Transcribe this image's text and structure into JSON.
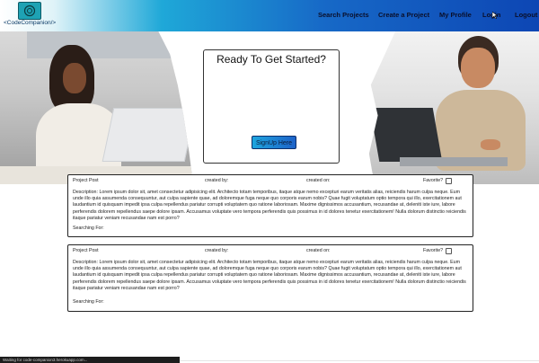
{
  "header": {
    "logo_text": "<CodeCompanion/>",
    "nav": [
      {
        "label": "Search Projects"
      },
      {
        "label": "Create a Project"
      },
      {
        "label": "My Profile"
      },
      {
        "label": "Login"
      },
      {
        "label": "Logout"
      }
    ],
    "colors": {
      "gradient_start": "#dff3f8",
      "gradient_end": "#0d46b4"
    }
  },
  "hero": {
    "title": "Ready To Get Started?",
    "signup_label": "SignUp Here"
  },
  "posts": [
    {
      "project_label": "Project Post",
      "created_by_label": "created by:",
      "created_on_label": "created on:",
      "favorite_label": "Favorite?",
      "description": "Description: Lorem ipsum dolor sit, amet consectetur adipisicing elit. Architecto totam temporibus, itaque atque nemo excepturi earum veritatis alias, reiciendis harum culpa neque. Eum unde illo quia assumenda consequuntur, aut culpa sapiente quae, ad doloremque fuga neque quo corporis earum nobis? Quae fugit voluptatum optio tempora qui illo, exercitationem aut laudantium id quisquam impedit ipsa culpa repellendus pariatur corrupti voluptatem quo ratione laboriosam. Maxime dignissimos accusantium, recusandae at, deleniti iste iure, labore perferendis dolorem repellendus saepe dolore ipsam. Accusamus voluptate vero tempora perferendis quis possimus in id dolores tenetur exercitationem! Nulla dolorum distinctio reiciendis itaque pariatur veniam recusandae nam est porro?",
      "searching_label": "Searching For:"
    },
    {
      "project_label": "Project Post",
      "created_by_label": "created by:",
      "created_on_label": "created on:",
      "favorite_label": "Favorite?",
      "description": "Description: Lorem ipsum dolor sit, amet consectetur adipisicing elit. Architecto totam temporibus, itaque atque nemo excepturi earum veritatis alias, reiciendis harum culpa neque. Eum unde illo quia assumenda consequuntur, aut culpa sapiente quae, ad doloremque fuga neque quo corporis earum nobis? Quae fugit voluptatum optio tempora qui illo, exercitationem aut laudantium id quisquam impedit ipsa culpa repellendus pariatur corrupti voluptatem quo ratione laboriosam. Maxime dignissimos accusantium, recusandae at, deleniti iste iure, labore perferendis dolorem repellendus saepe dolore ipsam. Accusamus voluptate vero tempora perferendis quis possimus in id dolores tenetur exercitationem! Nulla dolorum distinctio reiciendis itaque pariatur veniam recusandae nam est porro?",
      "searching_label": "Searching For:"
    }
  ],
  "status_bar": {
    "text": "Waiting for code-companion3.herokuapp.com..."
  }
}
